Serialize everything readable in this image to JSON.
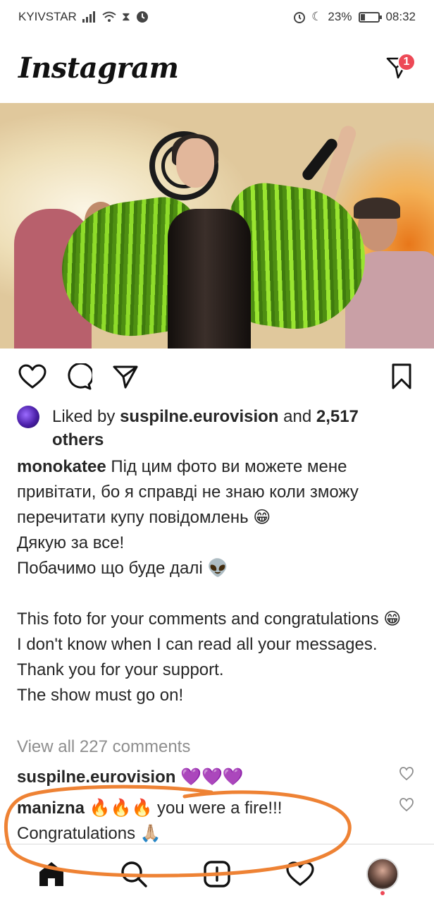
{
  "status_bar": {
    "carrier": "KYIVSTAR",
    "battery": "23%",
    "time": "08:32",
    "battery_level": 0.23,
    "icons": [
      "signal-icon",
      "wifi-icon",
      "hourglass-icon",
      "clock-icon",
      "alarm-icon",
      "moon-icon",
      "battery-icon"
    ]
  },
  "header": {
    "logo": "Instagram",
    "dm_badge": "1"
  },
  "post": {
    "image_alt": "stage performance photo",
    "likes": {
      "prefix": "Liked by ",
      "user": "suspilne.eurovision",
      "middle": " and ",
      "count": "2,517 others"
    },
    "caption": {
      "user": "monokatee",
      "lines": [
        "Під цим фото ви можете мене привітати, бо я справді не знаю коли зможу перечитати купу повідомлень 😁",
        "Дякую за все!",
        "Побачимо що буде далі 👽",
        "",
        "This foto for your comments and congratulations 😁",
        "I don't know when I can read all your messages. Thank you for  your support.",
        "The show must go on!"
      ]
    },
    "view_all": "View all 227 comments",
    "comments": [
      {
        "user": "suspilne.eurovision",
        "text": "💜💜💜"
      },
      {
        "user": "manizna",
        "text": "🔥🔥🔥 you were a fire!!! Congratulations 🙏🏼"
      }
    ]
  },
  "colors": {
    "annotation": "#ee8234",
    "badge": "#ed4956"
  }
}
